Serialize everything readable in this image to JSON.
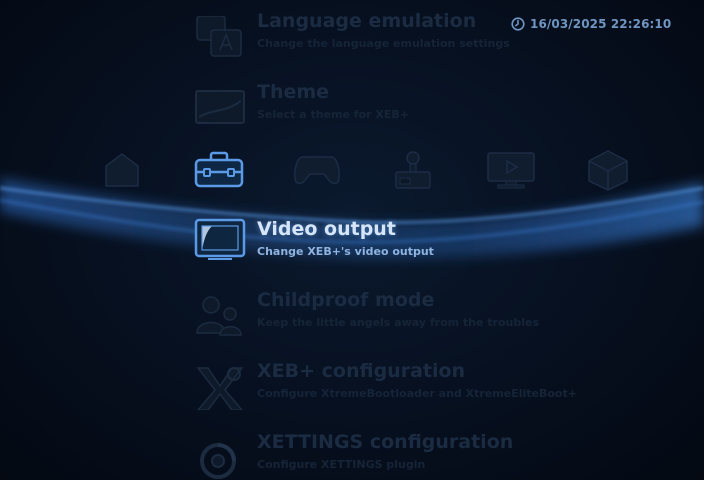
{
  "clock": {
    "icon": "clock-icon",
    "datetime": "16/03/2025 22:26:10"
  },
  "categories": [
    {
      "id": "home",
      "icon": "home-icon"
    },
    {
      "id": "settings",
      "icon": "toolbox-icon",
      "selected": true
    },
    {
      "id": "game",
      "icon": "gamepad-icon"
    },
    {
      "id": "network",
      "icon": "network-device-icon"
    },
    {
      "id": "video",
      "icon": "tv-play-icon"
    },
    {
      "id": "package",
      "icon": "package-box-icon"
    }
  ],
  "menu": {
    "items": [
      {
        "title": "Language emulation",
        "desc": "Change the language emulation settings",
        "icon": "language-icon"
      },
      {
        "title": "Theme",
        "desc": "Select a theme for XEB+",
        "icon": "theme-icon"
      },
      {
        "title": "Video output",
        "desc": "Change XEB+'s video output",
        "icon": "display-icon",
        "selected": true
      },
      {
        "title": "Childproof mode",
        "desc": "Keep the little angels away from the troubles",
        "icon": "users-icon"
      },
      {
        "title": "XEB+ configuration",
        "desc": "Configure XtremeBootloader and XtremeEliteBoot+",
        "icon": "xeb-logo-icon"
      },
      {
        "title": "XETTINGS configuration",
        "desc": "Configure XETTINGS plugin",
        "icon": "xettings-icon"
      }
    ]
  },
  "colors": {
    "accent": "#4f8fe0",
    "dim_text": "#1b2b42",
    "selected_title": "#d6e6fa",
    "background": "#050b16"
  }
}
